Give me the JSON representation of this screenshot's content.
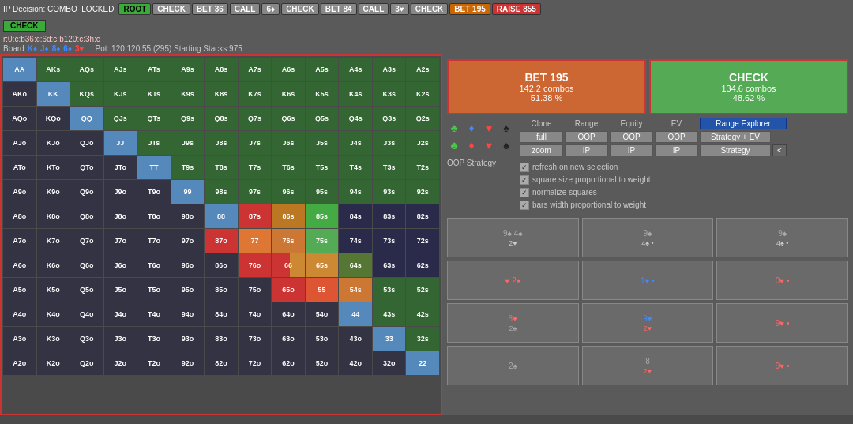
{
  "topBar": {
    "ip_decision": "IP Decision: COMBO_LOCKED",
    "buttons": [
      {
        "label": "ROOT",
        "style": "btn-green"
      },
      {
        "label": "CHECK",
        "style": "btn-gray"
      },
      {
        "label": "BET 36",
        "style": "btn-gray"
      },
      {
        "label": "CALL",
        "style": "btn-gray"
      },
      {
        "label": "6♦",
        "style": "btn-gray"
      },
      {
        "label": "CHECK",
        "style": "btn-gray"
      },
      {
        "label": "BET 84",
        "style": "btn-gray"
      },
      {
        "label": "CALL",
        "style": "btn-gray"
      },
      {
        "label": "3♥",
        "style": "btn-gray"
      },
      {
        "label": "CHECK",
        "style": "btn-gray"
      },
      {
        "label": "BET 195",
        "style": "btn-orange"
      },
      {
        "label": "RAISE 855",
        "style": "btn-raise"
      }
    ]
  },
  "secondBar": {
    "check_label": "CHECK"
  },
  "infoBar": {
    "path": "r:0:c:b36:c:6d:c:b120:c:3h:c",
    "board_label": "Board",
    "board_cards": [
      "K♦",
      "J♦",
      "8♦",
      "6♦",
      "3♥"
    ],
    "pot_line": "Pot: 120 120 55 (295) Starting Stacks:975"
  },
  "decisionBoxes": {
    "bet": {
      "title": "BET 195",
      "combos": "142.2 combos",
      "pct": "51.38 %"
    },
    "check": {
      "title": "CHECK",
      "combos": "134.6 combos",
      "pct": "48.62 %"
    }
  },
  "suits": {
    "row1": [
      "♣",
      "♦",
      "♥",
      "♠"
    ],
    "row2": [
      "♣",
      "♦",
      "♥",
      "♠"
    ]
  },
  "controls": {
    "clone_label": "Clone",
    "range_label": "Range",
    "equity_label": "Equity",
    "ev_label": "EV",
    "range_explorer": "Range Explorer",
    "full_label": "full",
    "oop_label": "OOP",
    "oop2_label": "OOP",
    "oop3_label": "OOP",
    "strategy_ev": "Strategy + EV",
    "zoom_label": "zoom",
    "ip_label": "IP",
    "ip2_label": "IP",
    "ip3_label": "IP",
    "strategy_label": "Strategy",
    "chevron": "<"
  },
  "oopStrategy": {
    "label": "OOP Strategy"
  },
  "checkboxes": [
    {
      "label": "refresh on new selection",
      "checked": true
    },
    {
      "label": "square size proportional to weight",
      "checked": true
    },
    {
      "label": "normalize squares",
      "checked": true
    },
    {
      "label": "bars width proportional to weight",
      "checked": true
    }
  ],
  "cardGrid": [
    {
      "rank": "9♠",
      "suits": "4♠ 2♥",
      "row": 0,
      "col": 0
    },
    {
      "rank": "9♠",
      "suits": "4♠ •",
      "row": 0,
      "col": 1
    },
    {
      "rank": "9♠",
      "suits": "4♠ •",
      "row": 0,
      "col": 2
    },
    {
      "rank": "♥ 2♠",
      "suits": "",
      "row": 1,
      "col": 0
    },
    {
      "rank": "1♥ •",
      "suits": "",
      "row": 1,
      "col": 1
    },
    {
      "rank": "0♥ •",
      "suits": "",
      "row": 1,
      "col": 2
    },
    {
      "rank": "8♥ 2♠",
      "suits": "",
      "row": 2,
      "col": 0
    },
    {
      "rank": "9♥ 2♥",
      "suits": "",
      "row": 2,
      "col": 1
    },
    {
      "rank": "9♥ •",
      "suits": "",
      "row": 2,
      "col": 2
    },
    {
      "rank": "2♠",
      "suits": "",
      "row": 3,
      "col": 0
    },
    {
      "rank": "8 2♥",
      "suits": "",
      "row": 3,
      "col": 1
    },
    {
      "rank": "9♥ •",
      "suits": "",
      "row": 3,
      "col": 2
    }
  ],
  "handGrid": {
    "headers": [
      "AA",
      "AKs",
      "AQs",
      "AJs",
      "ATs",
      "A9s",
      "A8s",
      "A7s",
      "A6s",
      "A5s",
      "A4s",
      "A3s",
      "A2s"
    ],
    "rows": [
      [
        "AA",
        "AKs",
        "AQs",
        "AJs",
        "ATs",
        "A9s",
        "A8s",
        "A7s",
        "A6s",
        "A5s",
        "A4s",
        "A3s",
        "A2s"
      ],
      [
        "AKo",
        "KK",
        "KQs",
        "KJs",
        "KTs",
        "K9s",
        "K8s",
        "K7s",
        "K6s",
        "K5s",
        "K4s",
        "K3s",
        "K2s"
      ],
      [
        "AQo",
        "KQo",
        "QQ",
        "QJs",
        "QTs",
        "Q9s",
        "Q8s",
        "Q7s",
        "Q6s",
        "Q5s",
        "Q4s",
        "Q3s",
        "Q2s"
      ],
      [
        "AJo",
        "KJo",
        "QJo",
        "JJ",
        "JTs",
        "J9s",
        "J8s",
        "J7s",
        "J6s",
        "J5s",
        "J4s",
        "J3s",
        "J2s"
      ],
      [
        "ATo",
        "KTo",
        "QTo",
        "JTo",
        "TT",
        "T9s",
        "T8s",
        "T7s",
        "T6s",
        "T5s",
        "T4s",
        "T3s",
        "T2s"
      ],
      [
        "A9o",
        "K9o",
        "Q9o",
        "J9o",
        "T9o",
        "99",
        "98s",
        "97s",
        "96s",
        "95s",
        "94s",
        "93s",
        "92s"
      ],
      [
        "A8o",
        "K8o",
        "Q8o",
        "J8o",
        "T8o",
        "98o",
        "88",
        "87s",
        "86s",
        "85s",
        "84s",
        "83s",
        "82s"
      ],
      [
        "A7o",
        "K7o",
        "Q7o",
        "J7o",
        "T7o",
        "97o",
        "87o",
        "77",
        "76s",
        "75s",
        "74s",
        "73s",
        "72s"
      ],
      [
        "A6o",
        "K6o",
        "Q6o",
        "J6o",
        "T6o",
        "96o",
        "86o",
        "76o",
        "66",
        "65s",
        "64s",
        "63s",
        "62s"
      ],
      [
        "A5o",
        "K5o",
        "Q5o",
        "J5o",
        "T5o",
        "95o",
        "85o",
        "75o",
        "65o",
        "55",
        "54s",
        "53s",
        "52s"
      ],
      [
        "A4o",
        "K4o",
        "Q4o",
        "J4o",
        "T4o",
        "94o",
        "84o",
        "74o",
        "64o",
        "54o",
        "44",
        "43s",
        "42s"
      ],
      [
        "A3o",
        "K3o",
        "Q3o",
        "J3o",
        "T3o",
        "93o",
        "83o",
        "73o",
        "63o",
        "53o",
        "43o",
        "33",
        "32s"
      ],
      [
        "A2o",
        "K2o",
        "Q2o",
        "J2o",
        "T2o",
        "92o",
        "82o",
        "72o",
        "62o",
        "52o",
        "42o",
        "32o",
        "22"
      ]
    ],
    "colors": [
      [
        "pair",
        "suited",
        "suited",
        "suited",
        "suited",
        "suited",
        "suited",
        "suited",
        "suited",
        "suited",
        "suited",
        "suited",
        "suited"
      ],
      [
        "offsuit",
        "pair",
        "suited",
        "suited",
        "suited",
        "suited",
        "suited",
        "suited",
        "suited",
        "suited",
        "suited",
        "suited",
        "suited"
      ],
      [
        "offsuit",
        "offsuit",
        "pair",
        "suited",
        "suited",
        "suited",
        "suited",
        "suited",
        "suited",
        "suited",
        "suited",
        "suited",
        "suited"
      ],
      [
        "offsuit",
        "offsuit",
        "offsuit",
        "pair",
        "suited",
        "suited",
        "suited",
        "suited",
        "suited",
        "suited",
        "suited",
        "suited",
        "suited"
      ],
      [
        "offsuit",
        "offsuit",
        "offsuit",
        "offsuit",
        "pair",
        "suited",
        "suited",
        "suited",
        "suited",
        "suited",
        "suited",
        "suited",
        "suited"
      ],
      [
        "offsuit",
        "offsuit",
        "offsuit",
        "offsuit",
        "offsuit",
        "pair",
        "suited",
        "suited",
        "suited",
        "suited",
        "suited",
        "suited",
        "suited"
      ],
      [
        "offsuit",
        "offsuit",
        "offsuit",
        "offsuit",
        "offsuit",
        "offsuit",
        "pair",
        "hot1",
        "warm",
        "light-green",
        "dark",
        "dark",
        "dark"
      ],
      [
        "offsuit",
        "offsuit",
        "offsuit",
        "offsuit",
        "offsuit",
        "offsuit",
        "offsuit",
        "pair",
        "split-rg",
        "warm",
        "dark",
        "dark",
        "dark"
      ],
      [
        "offsuit",
        "offsuit",
        "offsuit",
        "offsuit",
        "offsuit",
        "offsuit",
        "offsuit",
        "offsuit",
        "pair",
        "hot2",
        "warm",
        "dark",
        "dark"
      ],
      [
        "offsuit",
        "offsuit",
        "offsuit",
        "offsuit",
        "offsuit",
        "offsuit",
        "offsuit",
        "offsuit",
        "offsuit",
        "pair",
        "suited",
        "suited",
        "suited"
      ],
      [
        "offsuit",
        "offsuit",
        "offsuit",
        "offsuit",
        "offsuit",
        "offsuit",
        "offsuit",
        "offsuit",
        "offsuit",
        "offsuit",
        "pair",
        "suited",
        "suited"
      ],
      [
        "offsuit",
        "offsuit",
        "offsuit",
        "offsuit",
        "offsuit",
        "offsuit",
        "offsuit",
        "offsuit",
        "offsuit",
        "offsuit",
        "offsuit",
        "pair",
        "suited"
      ],
      [
        "offsuit",
        "offsuit",
        "offsuit",
        "offsuit",
        "offsuit",
        "offsuit",
        "offsuit",
        "offsuit",
        "offsuit",
        "offsuit",
        "offsuit",
        "offsuit",
        "pair"
      ]
    ]
  }
}
